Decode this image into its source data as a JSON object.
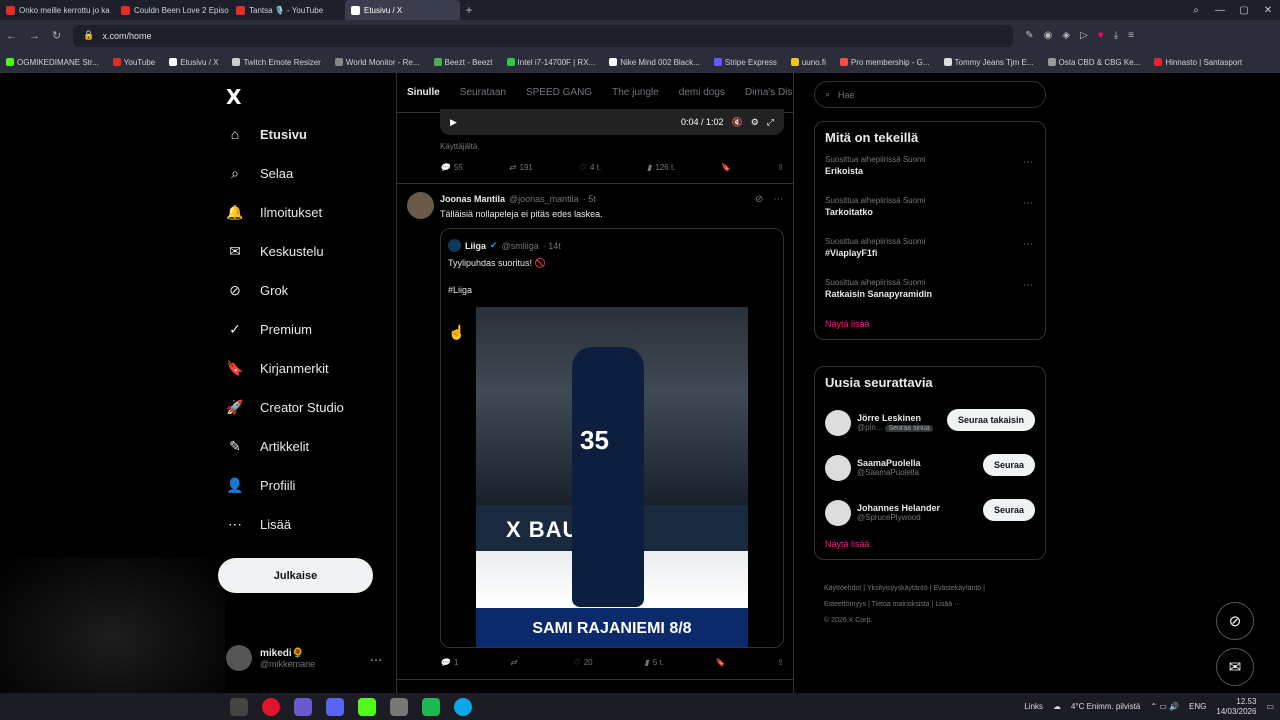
{
  "browser": {
    "tabs": [
      {
        "title": "Onko meille kerrottu jo ka",
        "color": "#e52d27",
        "active": false
      },
      {
        "title": "Couldn Been Love 2 Episo",
        "color": "#e52d27",
        "active": false
      },
      {
        "title": "Tantsa 🎙️ - YouTube",
        "color": "#e52d27",
        "active": false
      },
      {
        "title": "Etusivu / X",
        "color": "#ffffff",
        "active": true
      }
    ],
    "new_tab": "+",
    "url": "x.com/home",
    "bookmarks": [
      {
        "label": "OGMIKEDIMANE Str...",
        "color": "#53fc18"
      },
      {
        "label": "YouTube",
        "color": "#e52d27"
      },
      {
        "label": "Etusivu / X",
        "color": "#ffffff"
      },
      {
        "label": "Twitch Emote Resizer",
        "color": "#cccccc"
      },
      {
        "label": "World Monitor - Re...",
        "color": "#888888"
      },
      {
        "label": "Beezt - Beezt",
        "color": "#4caf50"
      },
      {
        "label": "Intel i7-14700F | RX...",
        "color": "#2ecc40"
      },
      {
        "label": "Nike Mind 002 Black...",
        "color": "#ffffff"
      },
      {
        "label": "Stripe Express",
        "color": "#635bff"
      },
      {
        "label": "uuno.fi",
        "color": "#f5c518"
      },
      {
        "label": "Pro membership - G...",
        "color": "#ff4d4d"
      },
      {
        "label": "Tommy Jeans Tjm E...",
        "color": "#dddddd"
      },
      {
        "label": "Osta CBD & CBG Ke...",
        "color": "#999999"
      },
      {
        "label": "Hinnasto | Santasport",
        "color": "#e8232a"
      }
    ]
  },
  "sidebar": {
    "logo": "X",
    "items": [
      {
        "label": "Etusivu",
        "icon": "⌂",
        "bold": true
      },
      {
        "label": "Selaa",
        "icon": "⌕"
      },
      {
        "label": "Ilmoitukset",
        "icon": "🔔"
      },
      {
        "label": "Keskustelu",
        "icon": "✉"
      },
      {
        "label": "Grok",
        "icon": "⊘"
      },
      {
        "label": "Premium",
        "icon": "✓"
      },
      {
        "label": "Kirjanmerkit",
        "icon": "🔖"
      },
      {
        "label": "Creator Studio",
        "icon": "🚀"
      },
      {
        "label": "Artikkelit",
        "icon": "✎"
      },
      {
        "label": "Profiili",
        "icon": "👤"
      },
      {
        "label": "Lisää",
        "icon": "⋯"
      }
    ],
    "post_button": "Julkaise",
    "account": {
      "name": "mikedi🌻",
      "handle": "@mikkemane"
    }
  },
  "timeline": {
    "tabs": [
      "Sinulle",
      "Seurataan",
      "SPEED GANG",
      "The jungle",
      "demi dogs",
      "Dima's Dist"
    ],
    "video": {
      "time": "0:04 / 1:02"
    },
    "from_label": "Käyttäjältä",
    "first_actions": {
      "replies": "55",
      "reposts": "191",
      "likes": "4 t.",
      "views": "126 t."
    },
    "tweet": {
      "name": "Joonas Mantila",
      "handle": "@joonas_mantila",
      "time": "· 5t",
      "text": "Tälläisiä nollapeleja ei pitäs edes laskea.",
      "quote": {
        "name": "Liiga",
        "handle": "@smliiga",
        "time": "· 14t",
        "text": "Tyylipuhdas suoritus! 🚫",
        "hashtag": "#Liiga",
        "image_board": "X BAUER",
        "image_number": "35",
        "image_caption": "SAMI RAJANIEMI 8/8"
      },
      "actions": {
        "replies": "1",
        "reposts": "",
        "likes": "20",
        "views": "5 t."
      }
    }
  },
  "right": {
    "search_placeholder": "Hae",
    "trends_title": "Mitä on tekeillä",
    "trends": [
      {
        "context": "Suosittua aihepiirissä Suomi",
        "name": "Erikoista"
      },
      {
        "context": "Suosittua aihepiirissä Suomi",
        "name": "Tarkoitatko"
      },
      {
        "context": "Suosittua aihepiirissä Suomi",
        "name": "#ViaplayF1fi"
      },
      {
        "context": "Suosittua aihepiirissä Suomi",
        "name": "Ratkaisin Sanapyramidin"
      }
    ],
    "show_more": "Näytä lisää",
    "who_title": "Uusia seurattavia",
    "who": [
      {
        "name": "Jörre Leskinen",
        "handle": "@pin...",
        "badge": "Seuraa sinua",
        "button": "Seuraa takaisin"
      },
      {
        "name": "SaamaPuolella",
        "handle": "@SaamaPuolella",
        "badge": "",
        "button": "Seuraa"
      },
      {
        "name": "Johannes Helander",
        "handle": "@SprucePlywood",
        "badge": "",
        "button": "Seuraa"
      }
    ],
    "who_show_more": "Näytä lisää",
    "footer_line1": "Käyttöehdot  |  Yksityisyyskäytäntö  |  Evästekäytäntö  |",
    "footer_line2": "Esteettömyys  |  Tietoa mainoksista  |  Lisää ···",
    "footer_line3": "© 2026 X Corp."
  },
  "taskbar": {
    "links": "Links",
    "weather": "4°C  Enimm. pilvistä",
    "lang": "ENG",
    "time": "12.53",
    "date": "14/03/2026"
  }
}
